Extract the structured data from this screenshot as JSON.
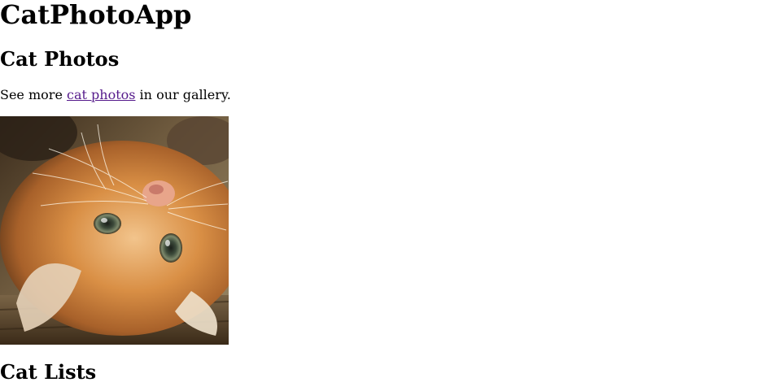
{
  "header": {
    "title": "CatPhotoApp"
  },
  "photos_section": {
    "heading": "Cat Photos",
    "text_before_link": "See more ",
    "link_text": "cat photos",
    "text_after_link": " in our gallery.",
    "image_subject": "orange tabby kitten lying on its back on wooden floor"
  },
  "lists_section": {
    "heading": "Cat Lists"
  },
  "colors": {
    "visited_link": "#551a8b",
    "text": "#000000",
    "background": "#ffffff"
  }
}
